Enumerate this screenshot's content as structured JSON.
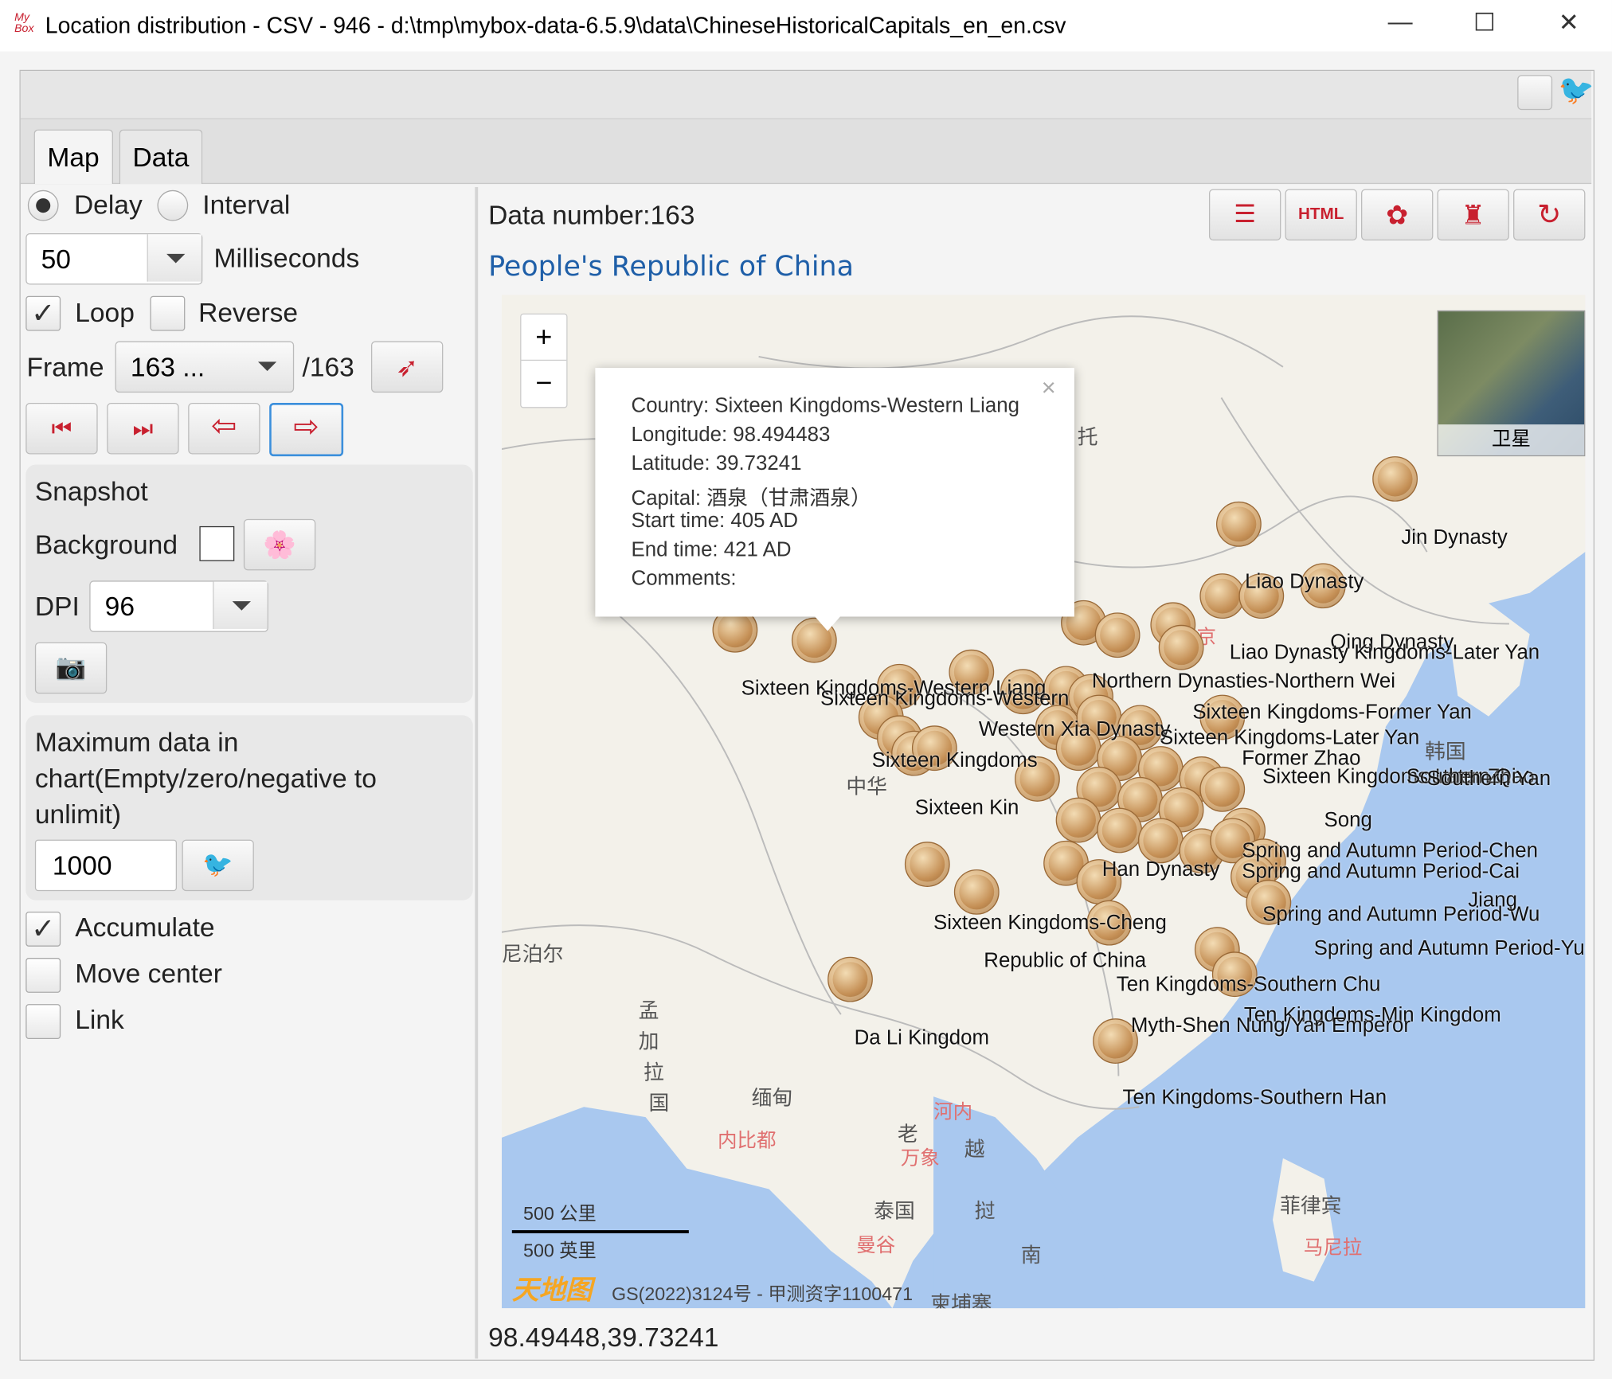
{
  "window": {
    "title": "Location distribution - CSV - 946 - d:\\tmp\\mybox-data-6.5.9\\data\\ChineseHistoricalCapitals_en_en.csv",
    "app_logo": "MyBox",
    "minimize": "—",
    "maximize": "☐",
    "close": "✕"
  },
  "tabs": [
    {
      "label": "Map"
    },
    {
      "label": "Data"
    }
  ],
  "controls": {
    "delay_label": "Delay",
    "interval_label": "Interval",
    "delay_value": "50",
    "milliseconds_label": "Milliseconds",
    "loop_label": "Loop",
    "loop_checked": true,
    "reverse_label": "Reverse",
    "frame_label": "Frame",
    "frame_value": "163 ...",
    "frame_total": "/163",
    "snapshot_title": "Snapshot",
    "background_label": "Background",
    "dpi_label": "DPI",
    "dpi_value": "96",
    "max_data_label": "Maximum data in chart(Empty/zero/negative to unlimit)",
    "max_data_value": "1000",
    "accumulate_label": "Accumulate",
    "accumulate_checked": true,
    "move_center_label": "Move center",
    "link_label": "Link"
  },
  "header": {
    "data_number": "Data number:163",
    "map_title": "People's Republic of China"
  },
  "map": {
    "zoom_in": "+",
    "zoom_out": "−",
    "satellite_label": "卫星",
    "popup": {
      "close": "×",
      "country": "Country: Sixteen Kingdoms-Western Liang",
      "longitude": "Longitude: 98.494483",
      "latitude": "Latitude: 39.73241",
      "capital": "Capital: 酒泉（甘肃酒泉）",
      "start": "Start time: 405 AD",
      "end": "End time: 421 AD",
      "comments": "Comments:"
    },
    "scale_km": "500 公里",
    "scale_mi": "500 英里",
    "copyright": "GS(2022)3124号 - 甲测资字1100471",
    "logo": "天地图",
    "place_names": [
      "尼泊尔",
      "孟",
      "加",
      "拉",
      "国",
      "缅甸",
      "老",
      "越",
      "泰国",
      "柬埔寨",
      "南",
      "菲律宾",
      "韩国",
      "中华",
      "挝",
      "托"
    ],
    "red_places": [
      "北京",
      "河内",
      "内比都",
      "万象",
      "曼谷",
      "马尼拉"
    ],
    "labels": [
      "Jin Dynasty",
      "Liao Dynasty",
      "Qing Dynasty",
      "Liao Dynasty Kingdoms-Later Yan",
      "Sixteen Kingdoms-Western Liang",
      "Sixteen Kingdoms-Western",
      "Northern Dynasties-Northern Wei",
      "Sixteen Kingdoms-Former Yan",
      "Western Xia Dynasty",
      "Sixteen Kingdoms-Later Yan",
      "Sixteen Kingdoms",
      "Former Zhao",
      "Sixteen Kingdoms-Later Zhao",
      "Southern Qi",
      "Southern Yan",
      "Sixteen Kin",
      "Spring and Autumn Period-Chen",
      "Spring and Autumn Period-Cai",
      "Han Dynasty",
      "Spring and Autumn Period-Wu",
      "Spring and Autumn Period-Yue",
      "Republic of China",
      "Sixteen Kingdoms-Cheng",
      "Ten Kingdoms-Southern Chu",
      "Ten Kingdoms-Min Kingdom",
      "Myth-Shen Nung/Yan Emperor",
      "Da Li Kingdom",
      "Ten Kingdoms-Southern Han",
      "Song",
      "Jiang"
    ]
  },
  "status": {
    "coordinates": "98.49448,39.73241"
  },
  "colors": {
    "accent": "#c8202f",
    "link": "#1f5fa8",
    "sea": "#a9c8ef"
  }
}
